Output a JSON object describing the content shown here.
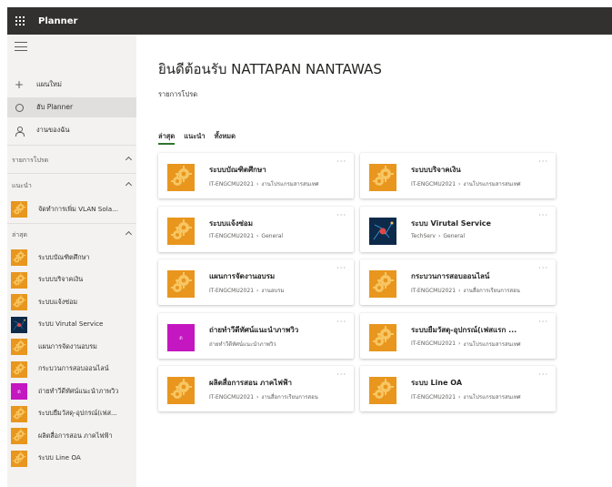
{
  "app": {
    "title": "Planner"
  },
  "nav": [
    {
      "label": "แผนใหม่",
      "icon": "plus-icon"
    },
    {
      "label": "ฮับ Planner",
      "icon": "circle-icon",
      "active": true
    },
    {
      "label": "งานของฉัน",
      "icon": "person-icon"
    }
  ],
  "sections": {
    "favorites": "รายการโปรด",
    "recommended": "แนะนำ",
    "recent": "ล่าสุด"
  },
  "recommended_items": [
    {
      "label": "จัดทำการเพิ่ม VLAN Sola...",
      "thumb": "orange"
    }
  ],
  "recent_items": [
    {
      "label": "ระบบบัณฑิตศึกษา",
      "thumb": "orange"
    },
    {
      "label": "ระบบบริจาคเงิน",
      "thumb": "orange"
    },
    {
      "label": "ระบบแจ้งซ่อม",
      "thumb": "orange"
    },
    {
      "label": "ระบบ Virutal Service",
      "thumb": "dark"
    },
    {
      "label": "แผนการจัดงานอบรม",
      "thumb": "orange"
    },
    {
      "label": "กระบวนการสอบออนไลน์",
      "thumb": "orange"
    },
    {
      "label": "ถ่ายทำวีดีทัศน์แนะนำภาพวิว",
      "thumb": "magenta",
      "initial": "ถ"
    },
    {
      "label": "ระบบยืมวัสดุ-อุปกรณ์(เฟส...",
      "thumb": "orange"
    },
    {
      "label": "ผลิตสื่อการสอน ภาคไฟฟ้า",
      "thumb": "orange"
    },
    {
      "label": "ระบบ Line OA",
      "thumb": "orange"
    }
  ],
  "main": {
    "welcome": "ยินดีต้อนรับ NATTAPAN NANTAWAS",
    "favorites_label": "รายการโปรด",
    "tabs": [
      "ล่าสุด",
      "แนะนำ",
      "ทั้งหมด"
    ]
  },
  "cards": [
    {
      "name": "ระบบบัณฑิตศึกษา",
      "group": "IT-ENGCMU2021",
      "bucket": "งานโปรแกรมสารสนเทศ",
      "thumb": "orange"
    },
    {
      "name": "ระบบบริจาคเงิน",
      "group": "IT-ENGCMU2021",
      "bucket": "งานโปรแกรมสารสนเทศ",
      "thumb": "orange"
    },
    {
      "name": "ระบบแจ้งซ่อม",
      "group": "IT-ENGCMU2021",
      "bucket": "General",
      "thumb": "orange"
    },
    {
      "name": "ระบบ Virutal Service",
      "group": "TechServ",
      "bucket": "General",
      "thumb": "dark"
    },
    {
      "name": "แผนการจัดงานอบรม",
      "group": "IT-ENGCMU2021",
      "bucket": "งานอบรม",
      "thumb": "orange"
    },
    {
      "name": "กระบวนการสอบออนไลน์",
      "group": "IT-ENGCMU2021",
      "bucket": "งานสื่อการเรียนการสอน",
      "thumb": "orange"
    },
    {
      "name": "ถ่ายทำวีดีทัศน์แนะนำภาพวิว",
      "group": "ถ่ายทำวีดีทัศน์แนะนำภาพวิว",
      "bucket": "",
      "thumb": "magenta",
      "initial": "ถ"
    },
    {
      "name": "ระบบยืมวัสดุ-อุปกรณ์(เฟสแรก ...",
      "group": "IT-ENGCMU2021",
      "bucket": "งานโปรแกรมสารสนเทศ",
      "thumb": "orange"
    },
    {
      "name": "ผลิตสื่อการสอน ภาคไฟฟ้า",
      "group": "IT-ENGCMU2021",
      "bucket": "งานสื่อการเรียนการสอน",
      "thumb": "orange"
    },
    {
      "name": "ระบบ Line OA",
      "group": "IT-ENGCMU2021",
      "bucket": "งานโปรแกรมสารสนเทศ",
      "thumb": "orange"
    }
  ],
  "colors": {
    "topbar": "#33312f",
    "sidebar": "#f3f2f1",
    "accent": "#31752f",
    "thumb_orange": "#e8961e",
    "thumb_magenta": "#c416c1",
    "thumb_dark": "#0d2a4a"
  }
}
